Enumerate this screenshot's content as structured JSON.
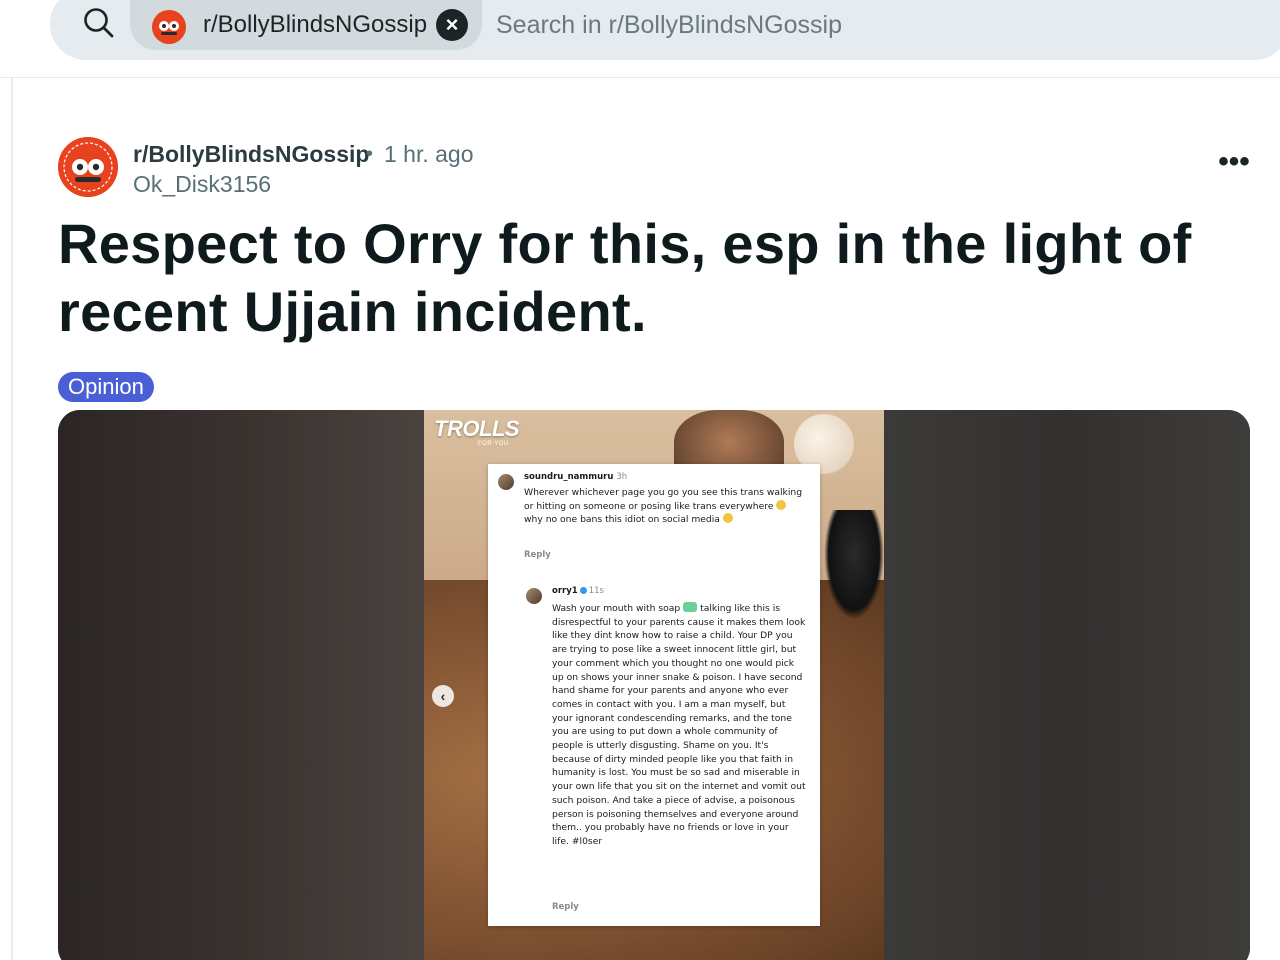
{
  "search": {
    "community_chip": "r/BollyBlindsNGossip",
    "placeholder": "Search in r/BollyBlindsNGossip"
  },
  "post": {
    "subreddit": "r/BollyBlindsNGossip",
    "separator": "•",
    "time": "1 hr. ago",
    "author": "Ok_Disk3156",
    "more": "•••",
    "title": "Respect to Orry for this, esp in the light of recent Ujjain incident.",
    "flair": "Opinion"
  },
  "media": {
    "logo": "TROLLS",
    "logo_sub": "FOR YOU",
    "prev_arrow": "‹",
    "comment1": {
      "user": "soundru_nammuru",
      "time": "3h",
      "text": "Wherever whichever page you go you see this trans walking or hitting on someone or posing like trans everywhere",
      "text_b": "why no one bans this idiot on social media",
      "reply": "Reply"
    },
    "comment2": {
      "user": "orry1",
      "time": "11s",
      "text_a": "Wash your mouth with soap",
      "text_b": "talking like this is disrespectful to your parents cause it makes them look like they dint know how to raise a child. Your DP you are trying to pose like a sweet innocent little girl, but your comment which you thought no one would pick up on shows your inner snake & poison. I have second hand shame for your parents and anyone who ever comes in contact with you. I am a man myself, but your ignorant condescending remarks, and the tone you are using to put down a whole community of people is utterly disgusting. Shame on you. It's because of dirty minded people like you that faith in humanity is lost. You must be so sad and miserable in your own life that you sit on the internet and vomit out such poison. And take a piece of advise, a poisonous person is poisoning themselves and everyone around them.. you probably have no friends or love in your life. #l0ser",
      "reply": "Reply"
    }
  },
  "colors": {
    "flair_bg": "#4a5fd6",
    "subreddit_icon": "#e8431f",
    "search_bg": "#e5ebee"
  }
}
